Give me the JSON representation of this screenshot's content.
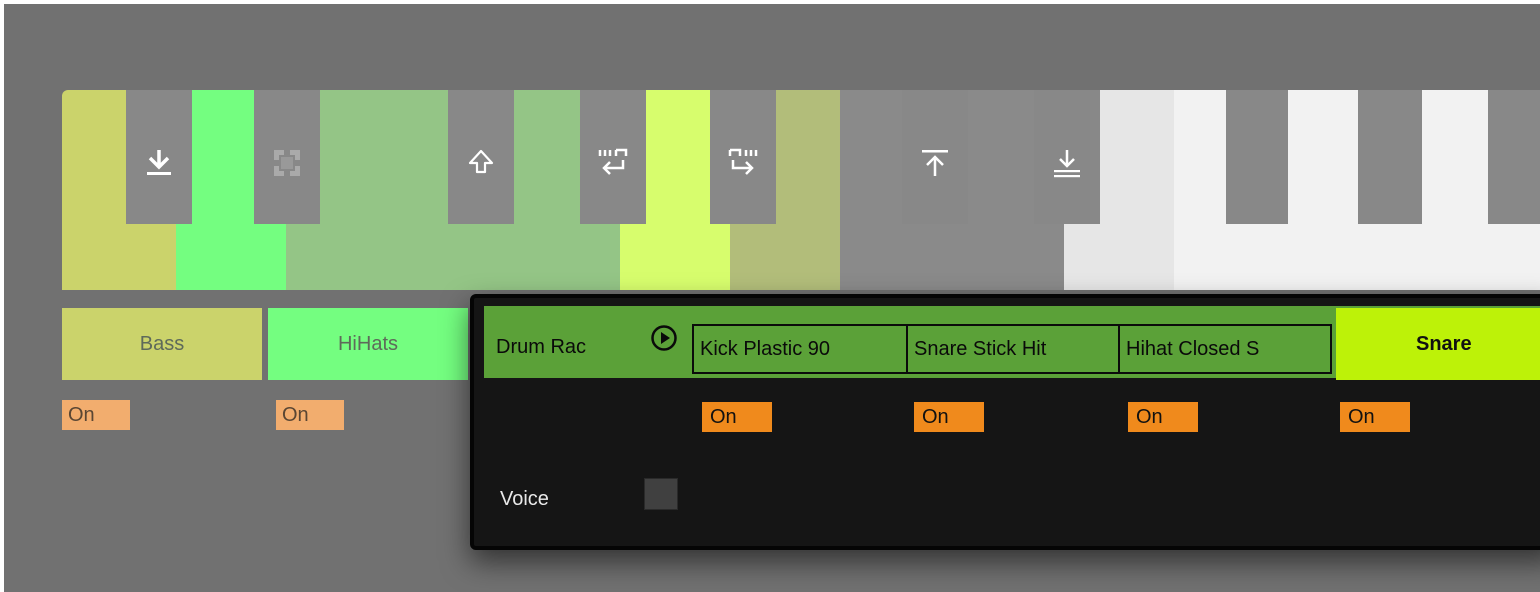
{
  "keyboard": {
    "white_key_colors": [
      "#cbd36b",
      "#74fe80",
      "#94c586",
      "#94c586",
      "#94c586",
      "#d7fd6d",
      "#b2bd7a",
      "#8a8a8a",
      "#8a8a8a",
      "#e6e6e6",
      "#f2f2f2",
      "#f2f2f2",
      "#f2f2f2",
      "#f2f2f2"
    ],
    "black_key_color": "#888888",
    "black_key_icons": [
      "arrow-down-to-line-icon",
      "crop-frame-icon",
      "arrow-up-outline-icon",
      "swap-left-icon",
      "swap-right-icon",
      "arrow-up-from-line-icon",
      "arrow-down-double-line-icon"
    ]
  },
  "chains": [
    {
      "name": "Bass",
      "color": "#cbd36b",
      "on_label": "On"
    },
    {
      "name": "HiHats",
      "color": "#74fe80",
      "on_label": "On"
    }
  ],
  "drum_rack": {
    "title": "Drum Rac",
    "bar_color": "#5ba138",
    "play_icon": "play-circle-icon",
    "pads": [
      {
        "name": "Kick Plastic 90",
        "on_label": "On"
      },
      {
        "name": "Snare Stick Hit",
        "on_label": "On"
      },
      {
        "name": "Hihat Closed S",
        "on_label": "On"
      }
    ],
    "voice_label": "Voice",
    "voice_toggle": "off"
  },
  "snare_chain": {
    "name": "Snare",
    "color": "#bdf208",
    "on_label": "On"
  }
}
